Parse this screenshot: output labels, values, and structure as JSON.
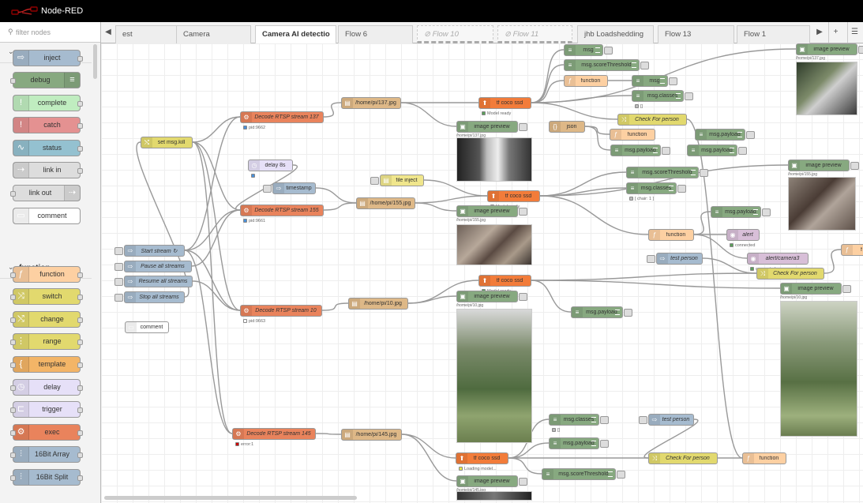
{
  "app": {
    "title": "Node-RED"
  },
  "palette": {
    "filter_placeholder": "filter nodes",
    "categories": [
      {
        "name": "common",
        "nodes": [
          {
            "label": "inject",
            "color": "#a6bbcf",
            "icon": "inject-arrow-icon"
          },
          {
            "label": "debug",
            "color": "#87a980",
            "icon": "debug-list-icon"
          },
          {
            "label": "complete",
            "color": "#c0edc0",
            "icon": "exclamation-icon"
          },
          {
            "label": "catch",
            "color": "#e49191",
            "icon": "exclamation-icon"
          },
          {
            "label": "status",
            "color": "#94c1d0",
            "icon": "pulse-icon"
          },
          {
            "label": "link in",
            "color": "#dddddd",
            "icon": "link-icon"
          },
          {
            "label": "link out",
            "color": "#dddddd",
            "icon": "link-icon"
          },
          {
            "label": "comment",
            "color": "#ffffff",
            "icon": "comment-icon"
          }
        ]
      },
      {
        "name": "function",
        "nodes": [
          {
            "label": "function",
            "color": "#fdd0a2",
            "icon": "function-icon"
          },
          {
            "label": "switch",
            "color": "#e2d96e",
            "icon": "switch-icon"
          },
          {
            "label": "change",
            "color": "#e2d96e",
            "icon": "change-icon"
          },
          {
            "label": "range",
            "color": "#e2d96e",
            "icon": "range-icon"
          },
          {
            "label": "template",
            "color": "#f3b567",
            "icon": "template-icon"
          },
          {
            "label": "delay",
            "color": "#e6e0f8",
            "icon": "timer-icon"
          },
          {
            "label": "trigger",
            "color": "#e6e0f8",
            "icon": "trigger-icon"
          },
          {
            "label": "exec",
            "color": "#e9835c",
            "icon": "gear-icon"
          },
          {
            "label": "16Bit Array",
            "color": "#a6bbcf",
            "icon": "split-icon"
          },
          {
            "label": "16Bit Split",
            "color": "#a6bbcf",
            "icon": "split-icon"
          }
        ]
      }
    ]
  },
  "tabs": [
    {
      "label": "est",
      "state": "normal"
    },
    {
      "label": "Camera",
      "state": "normal"
    },
    {
      "label": "Camera AI detectio",
      "state": "active"
    },
    {
      "label": "Flow 6",
      "state": "normal"
    },
    {
      "label": "Flow 10",
      "state": "disabled"
    },
    {
      "label": "Flow 11",
      "state": "disabled"
    },
    {
      "label": "jhb Loadshedding",
      "state": "normal"
    },
    {
      "label": "Flow 13",
      "state": "normal"
    },
    {
      "label": "Flow 1",
      "state": "normal"
    }
  ],
  "flow": {
    "nodes": [
      {
        "id": "setmsgkill",
        "label": "set msg.kill",
        "color": "#e2d96e",
        "icon": "change-icon"
      },
      {
        "id": "startstream",
        "label": "Start stream ↻",
        "color": "#a6bbcf",
        "icon": "inject-arrow-icon",
        "italic": true
      },
      {
        "id": "pausestreams",
        "label": "Pause all streams",
        "color": "#a6bbcf",
        "icon": "inject-arrow-icon",
        "italic": true
      },
      {
        "id": "resumestreams",
        "label": "Resume all streams",
        "color": "#a6bbcf",
        "icon": "inject-arrow-icon",
        "italic": true
      },
      {
        "id": "stopstreams",
        "label": "Stop all streams",
        "color": "#a6bbcf",
        "icon": "inject-arrow-icon",
        "italic": true
      },
      {
        "id": "comment",
        "label": "comment",
        "color": "#ffffff",
        "icon": "comment-icon"
      },
      {
        "id": "decode137",
        "label": "Decode RTSP stream 137",
        "color": "#e9835c",
        "icon": "gear-icon",
        "italic": true
      },
      {
        "id": "delay8",
        "label": "delay 8s",
        "color": "#e6e0f8",
        "icon": "timer-icon"
      },
      {
        "id": "timestamp",
        "label": "timestamp",
        "color": "#a6bbcf",
        "icon": "inject-arrow-icon"
      },
      {
        "id": "decode155",
        "label": "Decode RTSP stream 155",
        "color": "#e9835c",
        "icon": "gear-icon",
        "italic": true
      },
      {
        "id": "decode10",
        "label": "Decode RTSP stream 10",
        "color": "#e9835c",
        "icon": "gear-icon",
        "italic": true
      },
      {
        "id": "decode145",
        "label": "Decode RTSP stream 145",
        "color": "#e9835c",
        "icon": "gear-icon",
        "italic": true
      },
      {
        "id": "file137",
        "label": "/home/pi/137.jpg",
        "color": "#deb887",
        "icon": "file-icon"
      },
      {
        "id": "file155",
        "label": "/home/pi/155.jpg",
        "color": "#deb887",
        "icon": "file-icon"
      },
      {
        "id": "file10",
        "label": "/home/pi/10.jpg",
        "color": "#deb887",
        "icon": "file-icon"
      },
      {
        "id": "file145",
        "label": "/home/pi/145.jpg",
        "color": "#deb887",
        "icon": "file-icon"
      },
      {
        "id": "fileinject",
        "label": "file inject",
        "color": "#f0e68c",
        "icon": "file-icon"
      },
      {
        "id": "tfcoco1",
        "label": "tf coco ssd",
        "color": "#f27c3a",
        "icon": "tf-icon"
      },
      {
        "id": "tfcoco2",
        "label": "tf coco ssd",
        "color": "#f27c3a",
        "icon": "tf-icon"
      },
      {
        "id": "tfcoco3",
        "label": "tf coco ssd",
        "color": "#f27c3a",
        "icon": "tf-icon"
      },
      {
        "id": "tfcoco4",
        "label": "tf coco ssd",
        "color": "#f27c3a",
        "icon": "tf-icon"
      },
      {
        "id": "imgprev1",
        "label": "image preview",
        "color": "#87a980",
        "icon": "image-icon"
      },
      {
        "id": "imgprev2",
        "label": "image preview",
        "color": "#87a980",
        "icon": "image-icon"
      },
      {
        "id": "imgprev3",
        "label": "image preview",
        "color": "#87a980",
        "icon": "image-icon"
      },
      {
        "id": "imgprev4",
        "label": "image preview",
        "color": "#87a980",
        "icon": "image-icon"
      },
      {
        "id": "imgprev5",
        "label": "image preview",
        "color": "#87a980",
        "icon": "image-icon"
      },
      {
        "id": "imgprev6",
        "label": "image preview",
        "color": "#87a980",
        "icon": "image-icon"
      },
      {
        "id": "imgprev7",
        "label": "image preview",
        "color": "#87a980",
        "icon": "image-icon"
      },
      {
        "id": "msg1",
        "label": "msg",
        "color": "#87a980",
        "icon": "debug-list-icon"
      },
      {
        "id": "scorethr1",
        "label": "msg.scoreThreshold",
        "color": "#87a980",
        "icon": "debug-list-icon"
      },
      {
        "id": "function1",
        "label": "function",
        "color": "#fdd0a2",
        "icon": "function-icon"
      },
      {
        "id": "msg2",
        "label": "msg",
        "color": "#87a980",
        "icon": "debug-list-icon"
      },
      {
        "id": "classes1",
        "label": "msg.classes",
        "color": "#87a980",
        "icon": "debug-list-icon"
      },
      {
        "id": "checkperson1",
        "label": "Check For person",
        "color": "#e2d96e",
        "icon": "switch-icon",
        "italic": true
      },
      {
        "id": "json",
        "label": "json",
        "color": "#deb887",
        "icon": "json-icon"
      },
      {
        "id": "function2",
        "label": "function",
        "color": "#fdd0a2",
        "icon": "function-icon"
      },
      {
        "id": "payload1",
        "label": "msg.payload",
        "color": "#87a980",
        "icon": "debug-list-icon"
      },
      {
        "id": "payload2",
        "label": "msg.payload",
        "color": "#87a980",
        "icon": "debug-list-icon"
      },
      {
        "id": "payload3",
        "label": "msg.payload",
        "color": "#87a980",
        "icon": "debug-list-icon"
      },
      {
        "id": "function3",
        "label": "function",
        "color": "#fdd0a2",
        "icon": "function-icon"
      },
      {
        "id": "scorethr2",
        "label": "msg.scoreThreshold",
        "color": "#87a980",
        "icon": "debug-list-icon"
      },
      {
        "id": "classes2",
        "label": "msg.classes",
        "color": "#87a980",
        "icon": "debug-list-icon"
      },
      {
        "id": "payload4",
        "label": "msg.payload",
        "color": "#87a980",
        "icon": "debug-list-icon"
      },
      {
        "id": "function4",
        "label": "function",
        "color": "#fdd0a2",
        "icon": "function-icon"
      },
      {
        "id": "alert",
        "label": "alert",
        "color": "#d8bfd8",
        "icon": "alert-icon",
        "italic": true
      },
      {
        "id": "testperson1",
        "label": "test person",
        "color": "#a6bbcf",
        "icon": "inject-arrow-icon",
        "italic": true
      },
      {
        "id": "alertcam3",
        "label": "alert/camera3",
        "color": "#d8bfd8",
        "icon": "alert-icon",
        "italic": true
      },
      {
        "id": "checkperson2",
        "label": "Check For person",
        "color": "#e2d96e",
        "icon": "switch-icon",
        "italic": true
      },
      {
        "id": "function5",
        "label": "f",
        "color": "#fdd0a2",
        "icon": "function-icon"
      },
      {
        "id": "payload5",
        "label": "msg.payload",
        "color": "#87a980",
        "icon": "debug-list-icon"
      },
      {
        "id": "classes3",
        "label": "msg.classes",
        "color": "#87a980",
        "icon": "debug-list-icon"
      },
      {
        "id": "payload6",
        "label": "msg.payload",
        "color": "#87a980",
        "icon": "debug-list-icon"
      },
      {
        "id": "testperson2",
        "label": "test person",
        "color": "#a6bbcf",
        "icon": "inject-arrow-icon",
        "italic": true
      },
      {
        "id": "scorethr3",
        "label": "msg.scoreThreshold",
        "color": "#87a980",
        "icon": "debug-list-icon"
      },
      {
        "id": "checkperson3",
        "label": "Check For person",
        "color": "#e2d96e",
        "icon": "switch-icon",
        "italic": true
      },
      {
        "id": "function6",
        "label": "function",
        "color": "#fdd0a2",
        "icon": "function-icon"
      }
    ],
    "statuses": {
      "decode137": {
        "text": "pid:9662",
        "color": "#4a90d9"
      },
      "decode155": {
        "text": "pid:9661",
        "color": "#4a90d9"
      },
      "decode10": {
        "text": "pid:9663",
        "color": "#ffffff"
      },
      "decode145": {
        "text": "error:1",
        "color": "#cc0000"
      },
      "delay8": {
        "text": "",
        "color": "#4a90d9"
      },
      "tfcoco1": {
        "text": "Model ready",
        "color": "#5a9e5a"
      },
      "tfcoco2": {
        "text": "Model ready",
        "color": "#5a9e5a"
      },
      "tfcoco3": {
        "text": "Model ready",
        "color": "#5a9e5a"
      },
      "tfcoco4": {
        "text": "Loading model...",
        "color": "#e8e84a"
      },
      "classes1": {
        "text": "[]",
        "color": "#bbbbbb"
      },
      "classes2": {
        "text": "[ chair: 1 ]",
        "color": "#bbbbbb"
      },
      "classes3": {
        "text": "[]",
        "color": "#bbbbbb"
      },
      "alert": {
        "text": "connected",
        "color": "#5a9e5a"
      },
      "alertcam3": {
        "text": "connected",
        "color": "#5a9e5a"
      }
    },
    "captions": {
      "imgprev1": "/home/pi/137.jpg",
      "imgprev2": "/home/pi/155.jpg",
      "imgprev3": "/home/pi/10.jpg",
      "imgprev4": "/home/pi/145.jpg",
      "imgprev5": "/home/pi/137.jpg",
      "imgprev6": "/home/pi/155.jpg",
      "imgprev7": "/home/pi/10.jpg"
    }
  }
}
